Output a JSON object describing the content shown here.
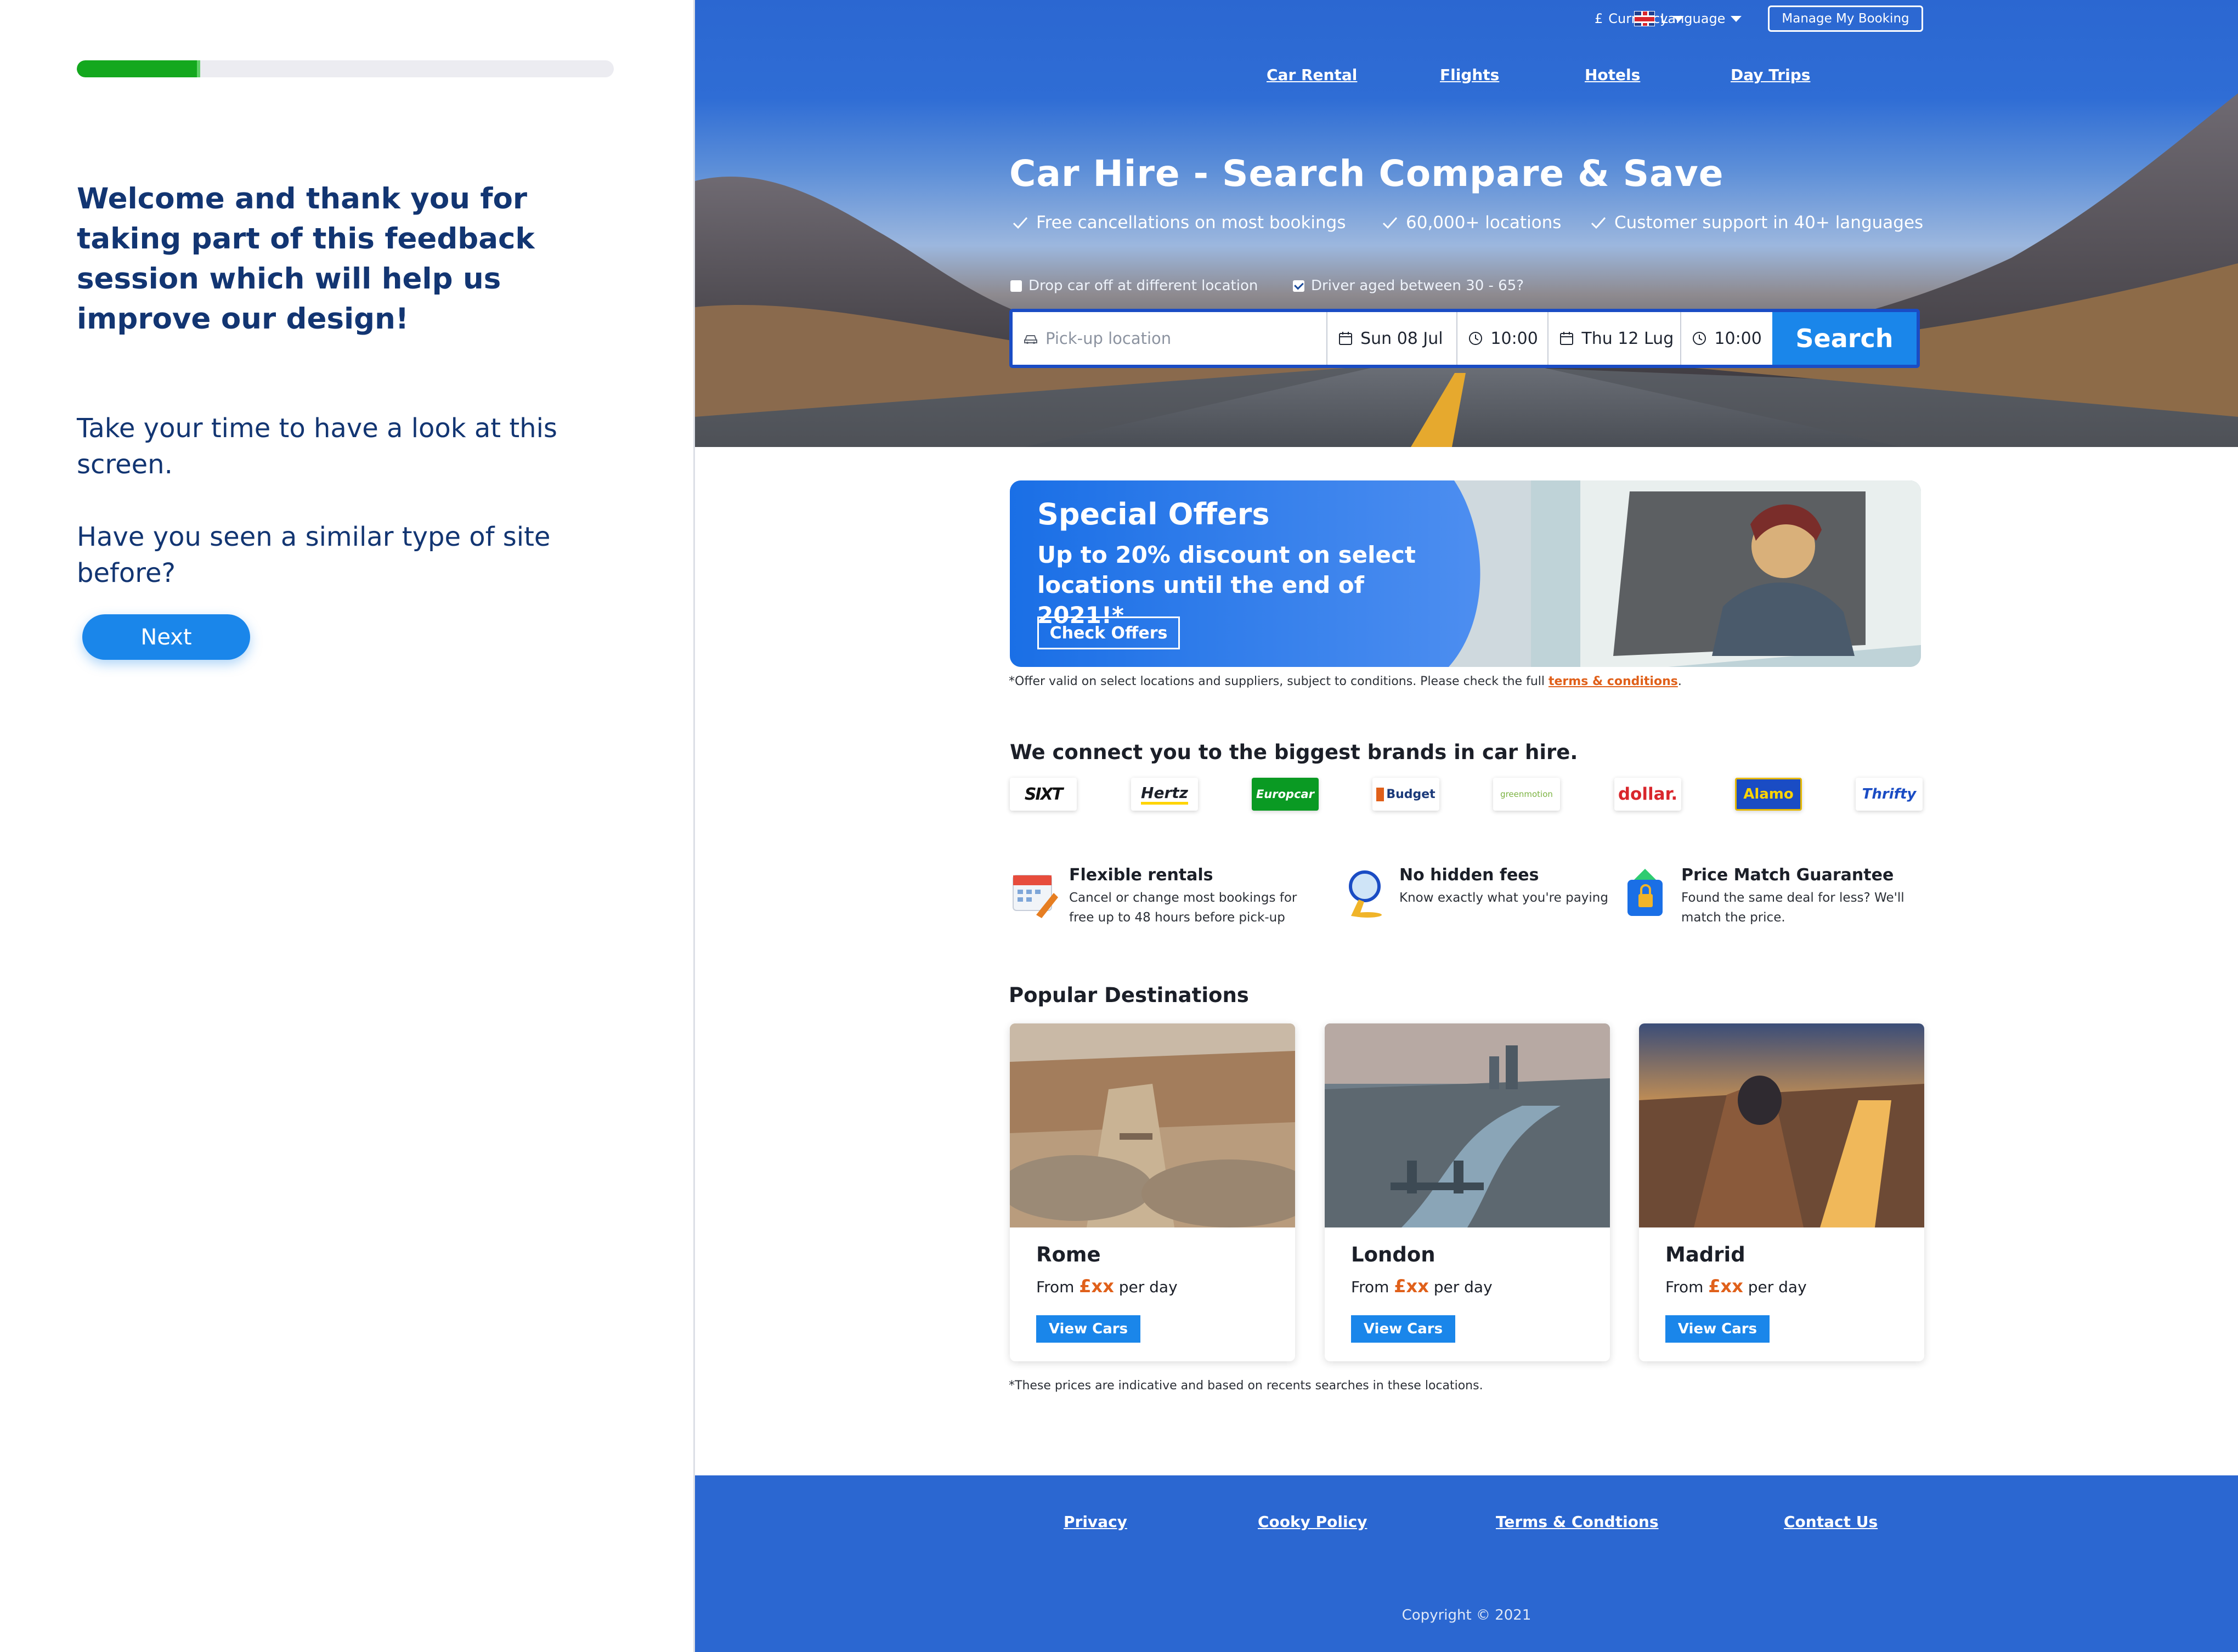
{
  "survey": {
    "progress_fraction": 0.23,
    "welcome": "Welcome and thank you for taking part of this feedback session which will help us improve our design!",
    "prompt_look": "Take your time to have a look at this screen.",
    "prompt_question": "Have you seen a similar type of site before?",
    "next_label": "Next"
  },
  "topbar": {
    "currency_symbol": "£",
    "currency_label": "Currency",
    "language_label": "Language",
    "manage_label": "Manage My Booking"
  },
  "nav": {
    "car_rental": "Car Rental",
    "flights": "Flights",
    "hotels": "Hotels",
    "day_trips": "Day Trips"
  },
  "hero": {
    "title": "Car Hire - Search Compare & Save",
    "benefits": [
      "Free cancellations on most bookings",
      "60,000+ locations",
      "Customer support in 40+ languages"
    ],
    "option_dropoff": "Drop car off at different location",
    "option_dropoff_checked": false,
    "option_age": "Driver aged between 30 - 65?",
    "option_age_checked": true
  },
  "search": {
    "location_placeholder": "Pick-up location",
    "pickup_date": "Sun 08 Jul",
    "pickup_time": "10:00",
    "dropoff_date": "Thu 12 Lug",
    "dropoff_time": "10:00",
    "button_label": "Search"
  },
  "offer": {
    "title": "Special Offers",
    "subtitle": "Up to 20% discount on select locations until the end of 2021!*",
    "button_label": "Check Offers",
    "fineprint": "*Offer valid on select locations and suppliers, subject to conditions. Please check the full",
    "terms_link": "terms & conditions",
    "terms_after": "."
  },
  "brands": {
    "heading": "We connect you to the biggest brands in car hire.",
    "items": [
      {
        "name": "SIXT",
        "color": "#111111"
      },
      {
        "name": "Hertz",
        "color": "#1b1f28"
      },
      {
        "name": "Europcar",
        "color": "#ffffff"
      },
      {
        "name": "Budget",
        "color": "#1b3a7a"
      },
      {
        "name": "greenmotion",
        "color": "#7cb342"
      },
      {
        "name": "dollar.",
        "color": "#d9262c"
      },
      {
        "name": "Alamo",
        "color": "#ffd400"
      },
      {
        "name": "Thrifty",
        "color": "#1a4cc4"
      }
    ]
  },
  "features": [
    {
      "icon": "calendar-icon",
      "title": "Flexible rentals",
      "text": "Cancel or change most bookings for free up to 48 hours before pick-up"
    },
    {
      "icon": "magnifier-icon",
      "title": "No hidden fees",
      "text": "Know exactly what you're paying"
    },
    {
      "icon": "wallet-lock-icon",
      "title": "Price Match Guarantee",
      "text": "Found the same deal for less? We'll match the price."
    }
  ],
  "destinations": {
    "heading": "Popular Destinations",
    "price_prefix": "From",
    "price_amount": "£xx",
    "price_suffix": "per day",
    "button_label": "View Cars",
    "items": [
      {
        "name": "Rome"
      },
      {
        "name": "London"
      },
      {
        "name": "Madrid"
      }
    ],
    "note": "*These prices are indicative and based on recents searches in these locations."
  },
  "footer": {
    "privacy": "Privacy",
    "cookie": "Cooky Policy",
    "terms": "Terms & Condtions",
    "contact": "Contact Us",
    "copyright": "Copyright © 2021"
  },
  "colors": {
    "brand_blue": "#2b67d1",
    "accent_blue": "#1a86ea",
    "navy_text": "#123572",
    "progress_green": "#14a81e",
    "price_orange": "#e0601a"
  }
}
